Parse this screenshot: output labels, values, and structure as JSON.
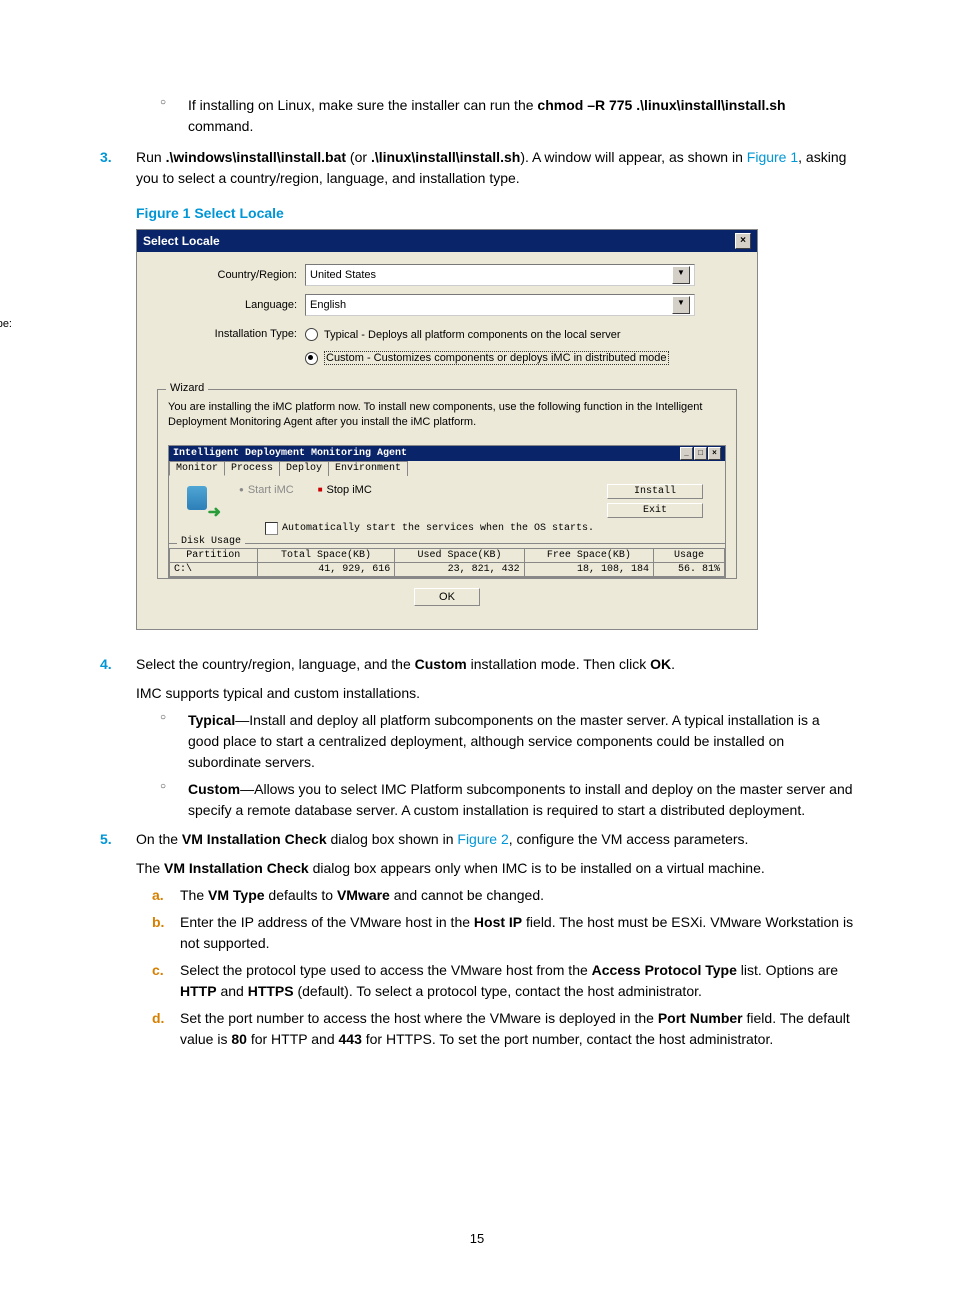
{
  "bullet1": {
    "prefix": "If installing on Linux, make sure the installer can run the ",
    "cmd": "chmod –R 775 .\\linux\\install\\install.sh",
    "suffix": " command."
  },
  "step3": {
    "num": "3.",
    "t1": "Run ",
    "cmd1": ".\\windows\\install\\install.bat",
    "t2": " (or ",
    "cmd2": ".\\linux\\install\\install.sh",
    "t3": "). A window will appear, as shown in ",
    "fig": "Figure 1",
    "t4": ", asking you to select a country/region, language, and installation type."
  },
  "fig1_caption": "Figure 1 Select Locale",
  "dialog": {
    "title": "Select Locale",
    "country_label": "Country/Region:",
    "country_value": "United States",
    "language_label": "Language:",
    "language_value": "English",
    "install_type_label": "Installation Type:",
    "radio_typical": "Typical - Deploys all platform components on the local server",
    "radio_custom": "Custom - Customizes components or deploys iMC in distributed mode",
    "wizard_legend": "Wizard",
    "wizard_text": "You are installing the iMC platform now. To install new components, use the following function in the Intelligent Deployment Monitoring Agent after you install the iMC platform.",
    "inner_title": "Intelligent Deployment Monitoring Agent",
    "tabs": [
      "Monitor",
      "Process",
      "Deploy",
      "Environment"
    ],
    "start_btn": "Start iMC",
    "stop_btn": "Stop iMC",
    "install_btn": "Install",
    "exit_btn": "Exit",
    "auto_text": "Automatically start the services when the OS starts.",
    "disk_legend": "Disk Usage",
    "cols": [
      "Partition",
      "Total Space(KB)",
      "Used Space(KB)",
      "Free Space(KB)",
      "Usage"
    ],
    "row": [
      "C:\\",
      "41, 929, 616",
      "23, 821, 432",
      "18, 108, 184",
      "56. 81%"
    ],
    "ok": "OK"
  },
  "step4": {
    "num": "4.",
    "line1a": "Select the country/region, language, and the ",
    "line1b": "Custom",
    "line1c": " installation mode. Then click ",
    "line1d": "OK",
    "line1e": ".",
    "line2": "IMC supports typical and custom installations.",
    "typ_label": "Typical",
    "typ_text": "—Install and deploy all platform subcomponents on the master server. A typical installation is a good place to start a centralized deployment, although service components could be installed on subordinate servers.",
    "cus_label": "Custom",
    "cus_text": "—Allows you to select IMC Platform subcomponents to install and deploy on the master server and specify a remote database server. A custom installation is required to start a distributed deployment."
  },
  "step5": {
    "num": "5.",
    "l1a": "On the ",
    "l1b": "VM Installation Check",
    "l1c": " dialog box shown in ",
    "l1d": "Figure 2",
    "l1e": ", configure the VM access parameters.",
    "l2a": "The ",
    "l2b": "VM Installation Check",
    "l2c": " dialog box appears only when IMC is to be installed on a virtual machine.",
    "a": {
      "m": "a.",
      "t1": "The ",
      "b1": "VM Type",
      "t2": " defaults to ",
      "b2": "VMware",
      "t3": " and cannot be changed."
    },
    "b": {
      "m": "b.",
      "t1": "Enter the IP address of the VMware host in the ",
      "b1": "Host IP",
      "t2": " field. The host must be ESXi. VMware Workstation is not supported."
    },
    "c": {
      "m": "c.",
      "t1": "Select the protocol type used to access the VMware host from the ",
      "b1": "Access Protocol Type",
      "t2": " list. Options are ",
      "b2": "HTTP",
      "t3": " and ",
      "b3": "HTTPS",
      "t4": " (default). To select a protocol type, contact the host administrator."
    },
    "d": {
      "m": "d.",
      "t1": "Set the port number to access the host where the VMware is deployed in the ",
      "b1": "Port Number",
      "t2": " field. The default value is ",
      "b2": "80",
      "t3": " for HTTP and ",
      "b3": "443",
      "t4": " for HTTPS. To set the port number, contact the host administrator."
    }
  },
  "page_num": "15"
}
